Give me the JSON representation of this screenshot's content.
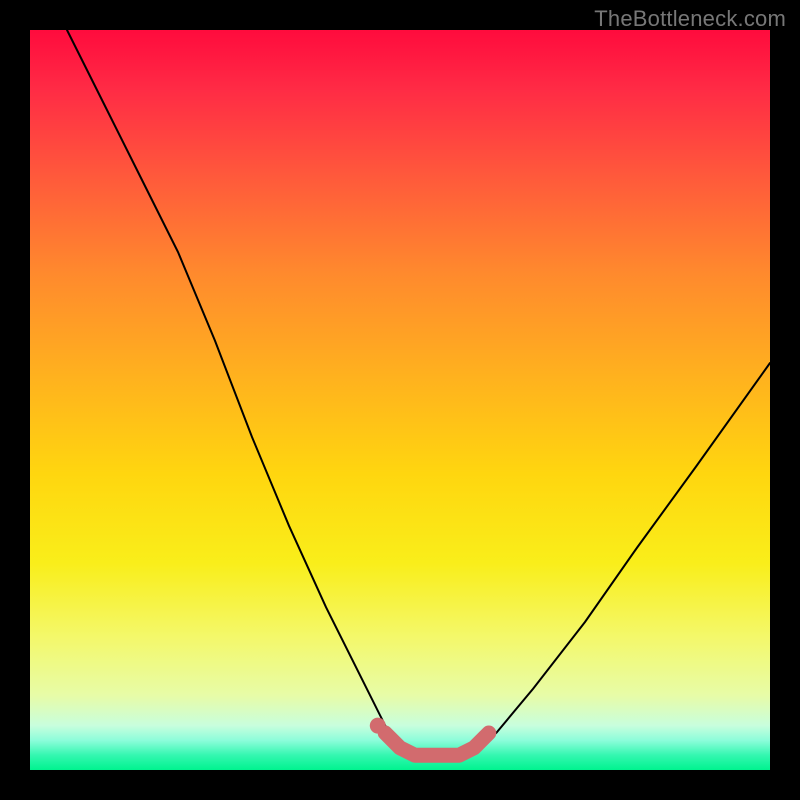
{
  "watermark": "TheBottleneck.com",
  "colors": {
    "background": "#000000",
    "curve": "#000000",
    "marker": "#d26b6e"
  },
  "chart_data": {
    "type": "line",
    "title": "",
    "xlabel": "",
    "ylabel": "",
    "xlim": [
      0,
      100
    ],
    "ylim": [
      0,
      100
    ],
    "grid": false,
    "legend": false,
    "series": [
      {
        "name": "bottleneck-curve",
        "x": [
          5,
          10,
          15,
          20,
          25,
          30,
          35,
          40,
          45,
          48,
          50,
          52,
          55,
          58,
          60,
          63,
          68,
          75,
          82,
          90,
          100
        ],
        "y": [
          100,
          90,
          80,
          70,
          58,
          45,
          33,
          22,
          12,
          6,
          3,
          2,
          2,
          2,
          3,
          5,
          11,
          20,
          30,
          41,
          55
        ]
      }
    ],
    "annotations": [
      {
        "name": "optimal-zone-marker",
        "x": [
          48,
          50,
          52,
          55,
          58,
          60,
          62
        ],
        "y": [
          5,
          3,
          2,
          2,
          2,
          3,
          5
        ]
      },
      {
        "name": "optimal-zone-dot",
        "point": {
          "x": 47,
          "y": 6
        }
      }
    ],
    "gradient_colors": {
      "top": "#ff0b3d",
      "mid_upper": "#ff8a2d",
      "mid": "#ffd60f",
      "mid_lower": "#f4f86a",
      "bottom": "#00f38f"
    }
  }
}
